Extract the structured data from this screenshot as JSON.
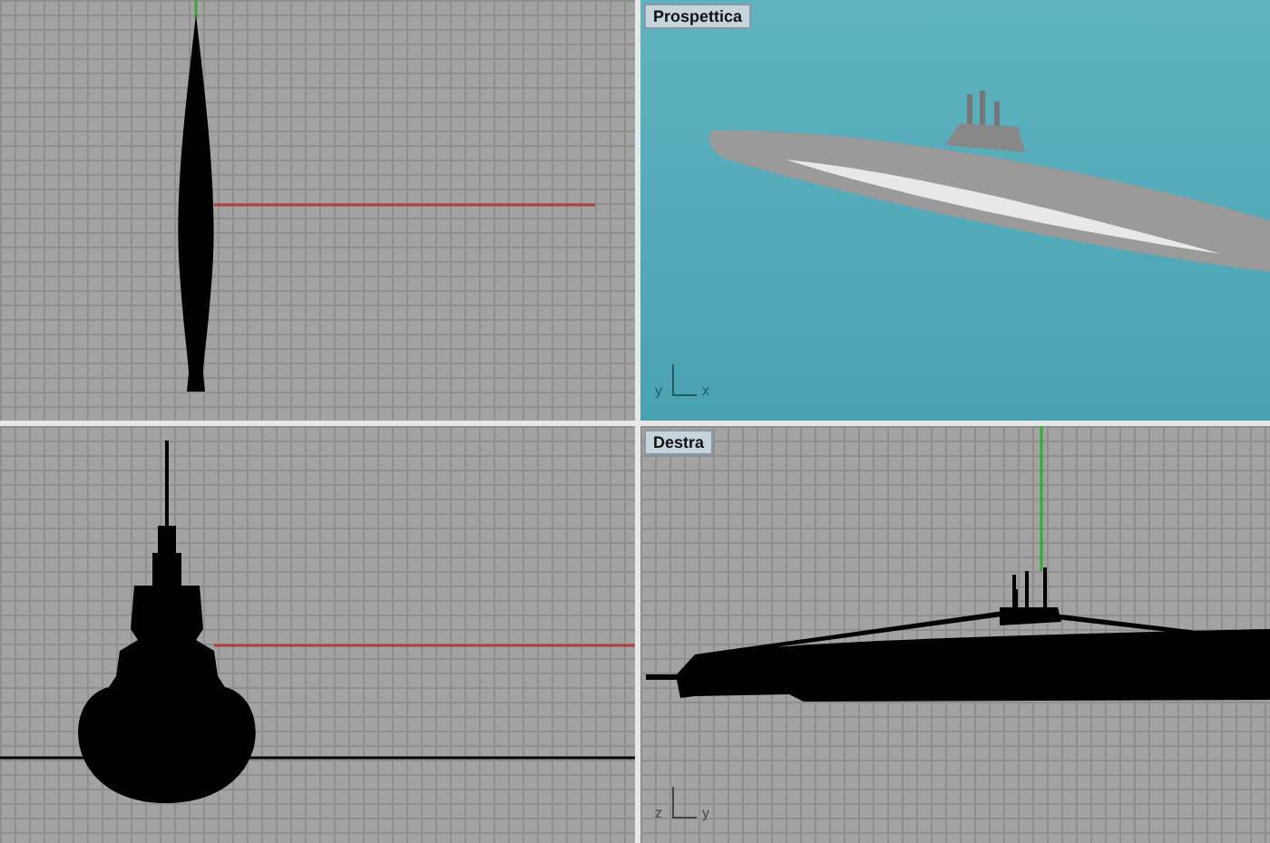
{
  "viewports": [
    {
      "kind": "top"
    },
    {
      "kind": "perspective",
      "title": "Prospettica",
      "axes": [
        "y",
        "x"
      ]
    },
    {
      "kind": "front"
    },
    {
      "kind": "right",
      "title": "Destra",
      "axes": [
        "z",
        "y"
      ]
    }
  ]
}
